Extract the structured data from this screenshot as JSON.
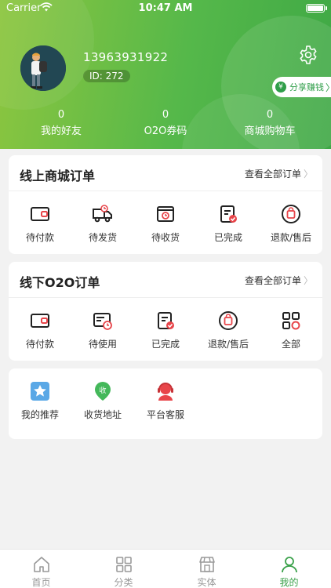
{
  "status_bar": {
    "carrier": "Carrier",
    "time": "10:47 AM"
  },
  "profile": {
    "phone": "13963931922",
    "id_label": "ID: 272"
  },
  "share": {
    "coin": "¥",
    "label": "分享赚钱",
    "chevron": "〉"
  },
  "stats": [
    {
      "value": "0",
      "label": "我的好友"
    },
    {
      "value": "0",
      "label": "O2O券码"
    },
    {
      "value": "0",
      "label": "商城购物车"
    }
  ],
  "online_orders": {
    "title": "线上商城订单",
    "view_all": "查看全部订单",
    "chevron": "〉",
    "items": [
      {
        "label": "待付款",
        "icon": "wallet-icon"
      },
      {
        "label": "待发货",
        "icon": "truck-icon"
      },
      {
        "label": "待收货",
        "icon": "box-clock-icon"
      },
      {
        "label": "已完成",
        "icon": "clipboard-check-icon"
      },
      {
        "label": "退款/售后",
        "icon": "refund-bag-icon"
      }
    ]
  },
  "offline_orders": {
    "title": "线下O2O订单",
    "view_all": "查看全部订单",
    "chevron": "〉",
    "items": [
      {
        "label": "待付款",
        "icon": "wallet-icon"
      },
      {
        "label": "待使用",
        "icon": "ticket-clock-icon"
      },
      {
        "label": "已完成",
        "icon": "clipboard-check-icon"
      },
      {
        "label": "退款/售后",
        "icon": "refund-bag-icon"
      },
      {
        "label": "全部",
        "icon": "grid-icon"
      }
    ]
  },
  "services": {
    "items": [
      {
        "label": "我的推荐",
        "icon": "star-badge-icon"
      },
      {
        "label": "收货地址",
        "icon": "location-pin-icon",
        "badge": "收"
      },
      {
        "label": "平台客服",
        "icon": "customer-service-icon"
      }
    ]
  },
  "tabs": [
    {
      "label": "首页",
      "icon": "home-icon"
    },
    {
      "label": "分类",
      "icon": "category-icon"
    },
    {
      "label": "实体",
      "icon": "store-icon"
    },
    {
      "label": "我的",
      "icon": "profile-icon",
      "active": true
    }
  ],
  "colors": {
    "brand_green": "#3aa14a",
    "accent_red": "#e8454a",
    "tab_inactive": "#999999"
  }
}
